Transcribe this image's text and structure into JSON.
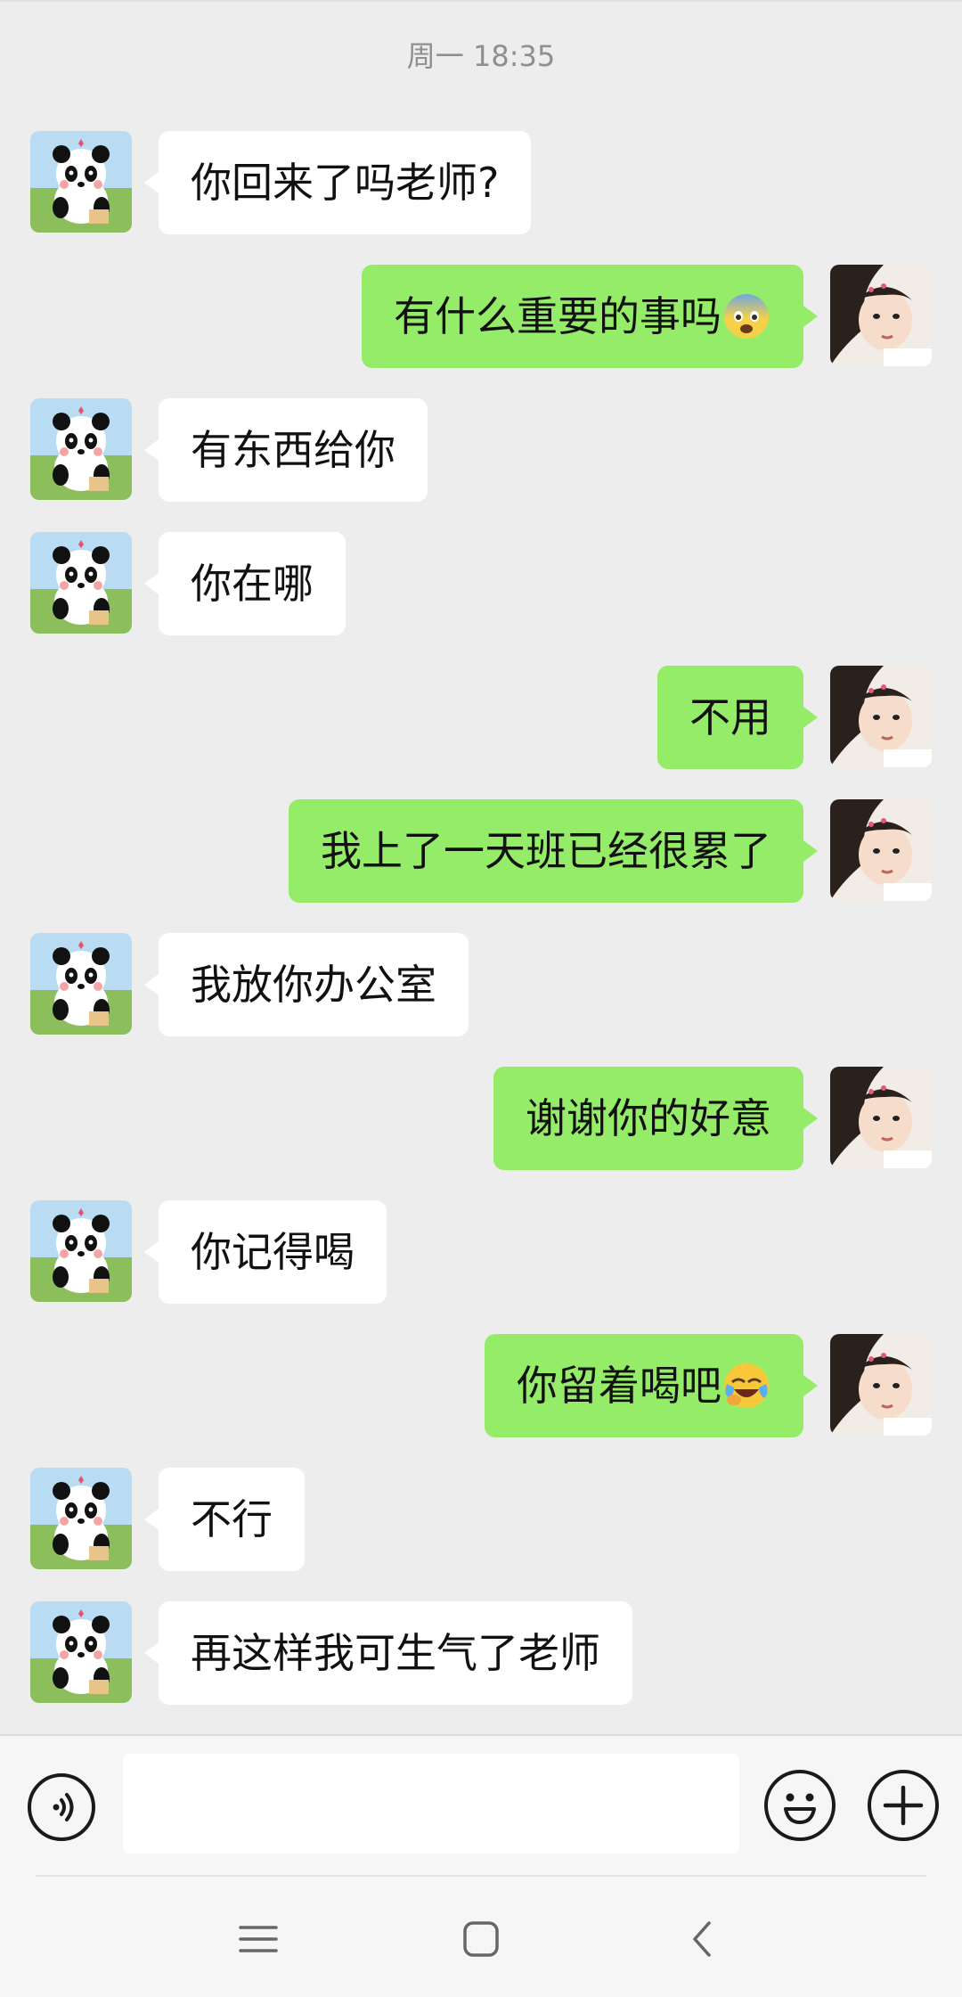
{
  "header": {
    "timestamp": "周一 18:35"
  },
  "messages": [
    {
      "side": "left",
      "text": "你回来了吗老师?"
    },
    {
      "side": "right",
      "text": "有什么重要的事吗",
      "emoji": "fearful-face-emoji"
    },
    {
      "side": "left",
      "text": "有东西给你"
    },
    {
      "side": "left",
      "text": "你在哪"
    },
    {
      "side": "right",
      "text": "不用"
    },
    {
      "side": "right",
      "text": "我上了一天班已经很累了"
    },
    {
      "side": "left",
      "text": "我放你办公室"
    },
    {
      "side": "right",
      "text": "谢谢你的好意"
    },
    {
      "side": "left",
      "text": "你记得喝"
    },
    {
      "side": "right",
      "text": "你留着喝吧",
      "emoji": "crying-laughing-face-emoji"
    },
    {
      "side": "left",
      "text": "不行"
    },
    {
      "side": "left",
      "text": "再这样我可生气了老师"
    }
  ],
  "avatars": {
    "left": "panda-avatar",
    "right": "girl-avatar"
  },
  "input_bar": {
    "voice_icon": "voice-icon",
    "input_value": "",
    "emoji_icon": "smiley-icon",
    "plus_icon": "plus-icon"
  },
  "nav": {
    "menu_icon": "menu-icon",
    "home_icon": "square-home-icon",
    "back_icon": "back-chevron-icon"
  },
  "colors": {
    "background": "#ededed",
    "bubble_incoming": "#ffffff",
    "bubble_outgoing": "#95ec69",
    "timestamp": "#8f8f8f"
  }
}
